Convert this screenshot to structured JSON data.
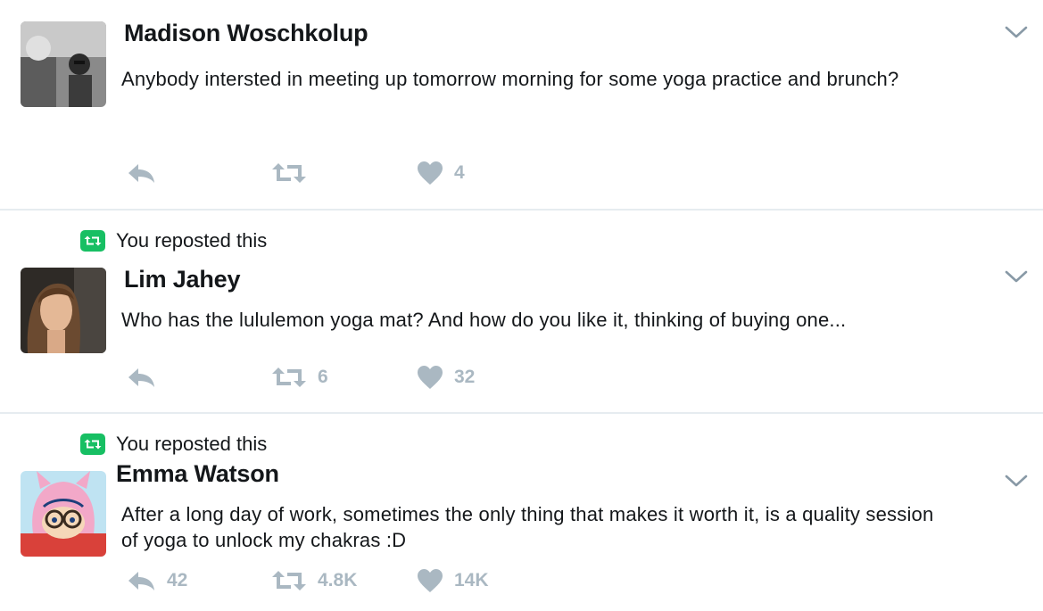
{
  "timeline": {
    "tweets": [
      {
        "author": "Madison Woschkolup",
        "text": "Anybody intersted in meeting up tomorrow morning for some yoga practice and brunch?",
        "reposted_label": "",
        "actions": {
          "reply_count": "",
          "retweet_count": "",
          "like_count": "4"
        }
      },
      {
        "author": "Lim Jahey",
        "text": "Who has the lululemon yoga mat? And how do you like it, thinking of buying one...",
        "reposted_label": "You reposted this",
        "actions": {
          "reply_count": "",
          "retweet_count": "6",
          "like_count": "32"
        }
      },
      {
        "author": "Emma Watson",
        "text": "After a long day of work, sometimes the only thing that makes it worth it, is a quality session of yoga to unlock my chakras :D",
        "reposted_label": "You reposted this",
        "actions": {
          "reply_count": "42",
          "retweet_count": "4.8K",
          "like_count": "14K"
        }
      }
    ]
  },
  "colors": {
    "icon_gray": "#aab8c2",
    "retweet_green": "#17bf63",
    "divider": "#e6ecf0",
    "chevron": "#8899a6"
  },
  "icons": {
    "reply": "reply-icon",
    "retweet": "retweet-icon",
    "like": "heart-icon",
    "more": "chevron-down-icon",
    "avatar": "avatar"
  }
}
